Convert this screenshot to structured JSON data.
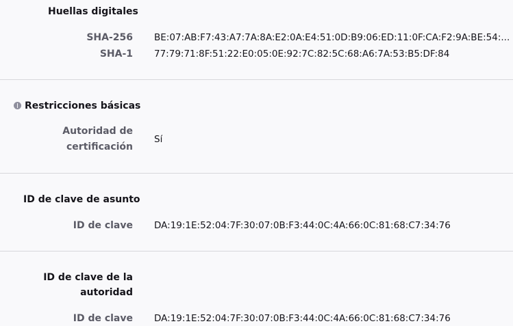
{
  "fingerprints": {
    "title": "Huellas digitales",
    "sha256_label": "SHA-256",
    "sha256_value": "BE:07:AB:F7:43:A7:7A:8A:E2:0A:E4:51:0D:B9:06:ED:11:0F:CA:F2:9A:BE:54:...",
    "sha1_label": "SHA-1",
    "sha1_value": "77:79:71:8F:51:22:E0:05:0E:92:7C:82:5C:68:A6:7A:53:B5:DF:84"
  },
  "basic_constraints": {
    "title": "Restricciones básicas",
    "icon": "critical-extension-icon",
    "ca_label_line1": "Autoridad de",
    "ca_label_line2": "certificación",
    "ca_value": "Sí"
  },
  "subject_key_id": {
    "title": "ID de clave de asunto",
    "key_label": "ID de clave",
    "key_value": "DA:19:1E:52:04:7F:30:07:0B:F3:44:0C:4A:66:0C:81:68:C7:34:76"
  },
  "authority_key_id": {
    "title_line1": "ID de clave de la",
    "title_line2": "autoridad",
    "key_label": "ID de clave",
    "key_value": "DA:19:1E:52:04:7F:30:07:0B:F3:44:0C:4A:66:0C:81:68:C7:34:76"
  }
}
